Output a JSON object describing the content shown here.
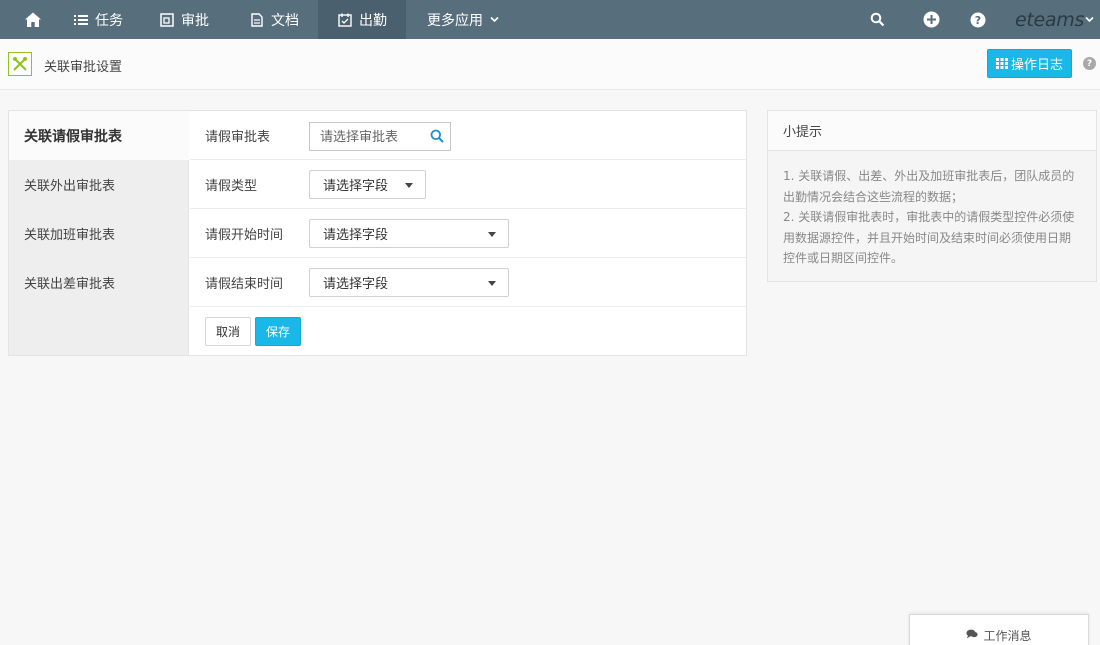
{
  "nav": {
    "items": [
      {
        "label": "任务",
        "icon": "list-icon"
      },
      {
        "label": "审批",
        "icon": "approval-icon"
      },
      {
        "label": "文档",
        "icon": "document-icon"
      },
      {
        "label": "出勤",
        "icon": "attendance-icon"
      },
      {
        "label": "更多应用",
        "icon": "chevron-down-icon"
      }
    ],
    "active": "出勤",
    "brand": "eteams"
  },
  "header": {
    "title": "关联审批设置",
    "log_button": "操作日志"
  },
  "sidebar": {
    "items": [
      {
        "label": "关联请假审批表",
        "active": true
      },
      {
        "label": "关联外出审批表",
        "active": false
      },
      {
        "label": "关联加班审批表",
        "active": false
      },
      {
        "label": "关联出差审批表",
        "active": false
      }
    ]
  },
  "form": {
    "rows": [
      {
        "label": "请假审批表",
        "control": "search",
        "placeholder": "请选择审批表"
      },
      {
        "label": "请假类型",
        "control": "select",
        "value": "请选择字段"
      },
      {
        "label": "请假开始时间",
        "control": "select",
        "value": "请选择字段"
      },
      {
        "label": "请假结束时间",
        "control": "select",
        "value": "请选择字段"
      }
    ],
    "cancel": "取消",
    "save": "保存"
  },
  "tips": {
    "title": "小提示",
    "lines": [
      "1. 关联请假、出差、外出及加班审批表后，团队成员的出勤情况会结合这些流程的数据；",
      "2. 关联请假审批表时，审批表中的请假类型控件必须使用数据源控件，并且开始时间及结束时间必须使用日期控件或日期区间控件。"
    ]
  },
  "footer": {
    "work_message": "工作消息"
  },
  "colors": {
    "nav_bg": "#576e7d",
    "accent": "#1ab8e8",
    "brand_green": "#8fc31f"
  }
}
